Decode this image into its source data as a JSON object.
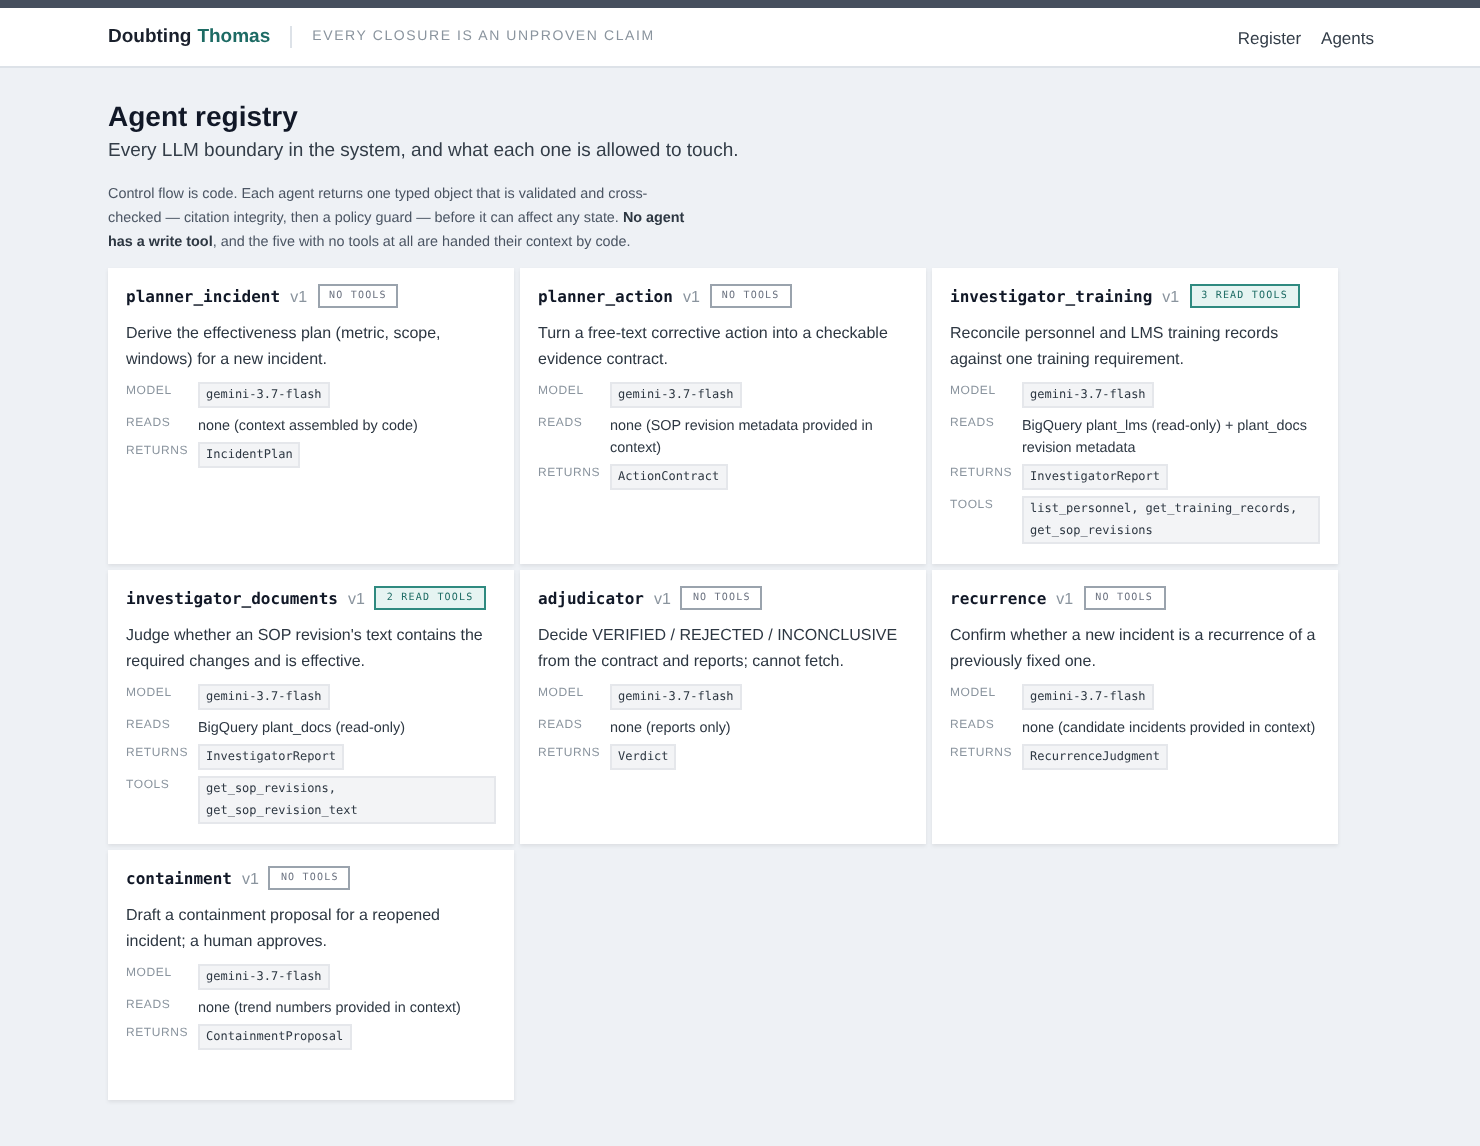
{
  "header": {
    "brand_first": "Doubting",
    "brand_second": "Thomas",
    "tagline": "EVERY CLOSURE IS AN UNPROVEN CLAIM",
    "nav": [
      "Register",
      "Agents"
    ]
  },
  "page": {
    "title": "Agent registry",
    "subtitle": "Every LLM boundary in the system, and what each one is allowed to touch.",
    "intro": "Control flow is code. Each agent returns one typed object that is validated and cross-checked — citation integrity, then a policy guard — before it can affect any state. **No agent has a write tool**, and the five with no tools at all are handed their context by code."
  },
  "agents": [
    {
      "name": "planner_incident",
      "version": "v1",
      "badge": "NO TOOLS",
      "kind": "none",
      "description": "Derive the effectiveness plan (metric, scope, windows) for a new incident.",
      "fields": [
        {
          "label": "MODEL",
          "value": "gemini-3.7-flash",
          "kind": "code"
        },
        {
          "label": "READS",
          "value": "none (context assembled by code)",
          "kind": "text"
        },
        {
          "label": "RETURNS",
          "value": "IncidentPlan",
          "kind": "code"
        }
      ]
    },
    {
      "name": "planner_action",
      "version": "v1",
      "badge": "NO TOOLS",
      "kind": "none",
      "description": "Turn a free-text corrective action into a checkable evidence contract.",
      "fields": [
        {
          "label": "MODEL",
          "value": "gemini-3.7-flash",
          "kind": "code"
        },
        {
          "label": "READS",
          "value": "none (SOP revision metadata provided in context)",
          "kind": "text"
        },
        {
          "label": "RETURNS",
          "value": "ActionContract",
          "kind": "code"
        }
      ]
    },
    {
      "name": "investigator_training",
      "version": "v1",
      "badge": "3 READ TOOLS",
      "kind": "read",
      "description": "Reconcile personnel and LMS training records against one training requirement.",
      "fields": [
        {
          "label": "MODEL",
          "value": "gemini-3.7-flash",
          "kind": "code"
        },
        {
          "label": "READS",
          "value": "BigQuery plant_lms (read-only) + plant_docs revision metadata",
          "kind": "text"
        },
        {
          "label": "RETURNS",
          "value": "InvestigatorReport",
          "kind": "code"
        },
        {
          "label": "TOOLS",
          "value": "list_personnel, get_training_records, get_sop_revisions",
          "kind": "code"
        }
      ]
    },
    {
      "name": "investigator_documents",
      "version": "v1",
      "badge": "2 READ TOOLS",
      "kind": "read",
      "description": "Judge whether an SOP revision's text contains the required changes and is effective.",
      "fields": [
        {
          "label": "MODEL",
          "value": "gemini-3.7-flash",
          "kind": "code"
        },
        {
          "label": "READS",
          "value": "BigQuery plant_docs (read-only)",
          "kind": "text"
        },
        {
          "label": "RETURNS",
          "value": "InvestigatorReport",
          "kind": "code"
        },
        {
          "label": "TOOLS",
          "value": "get_sop_revisions, get_sop_revision_text",
          "kind": "code"
        }
      ]
    },
    {
      "name": "adjudicator",
      "version": "v1",
      "badge": "NO TOOLS",
      "kind": "none",
      "description": "Decide VERIFIED / REJECTED / INCONCLUSIVE from the contract and reports; cannot fetch.",
      "fields": [
        {
          "label": "MODEL",
          "value": "gemini-3.7-flash",
          "kind": "code"
        },
        {
          "label": "READS",
          "value": "none (reports only)",
          "kind": "text"
        },
        {
          "label": "RETURNS",
          "value": "Verdict",
          "kind": "code"
        }
      ]
    },
    {
      "name": "recurrence",
      "version": "v1",
      "badge": "NO TOOLS",
      "kind": "none",
      "description": "Confirm whether a new incident is a recurrence of a previously fixed one.",
      "fields": [
        {
          "label": "MODEL",
          "value": "gemini-3.7-flash",
          "kind": "code"
        },
        {
          "label": "READS",
          "value": "none (candidate incidents provided in context)",
          "kind": "text"
        },
        {
          "label": "RETURNS",
          "value": "RecurrenceJudgment",
          "kind": "code"
        }
      ]
    },
    {
      "name": "containment",
      "version": "v1",
      "badge": "NO TOOLS",
      "kind": "none",
      "description": "Draft a containment proposal for a reopened incident; a human approves.",
      "fields": [
        {
          "label": "MODEL",
          "value": "gemini-3.7-flash",
          "kind": "code"
        },
        {
          "label": "READS",
          "value": "none (trend numbers provided in context)",
          "kind": "text"
        },
        {
          "label": "RETURNS",
          "value": "ContainmentProposal",
          "kind": "code"
        }
      ]
    }
  ]
}
